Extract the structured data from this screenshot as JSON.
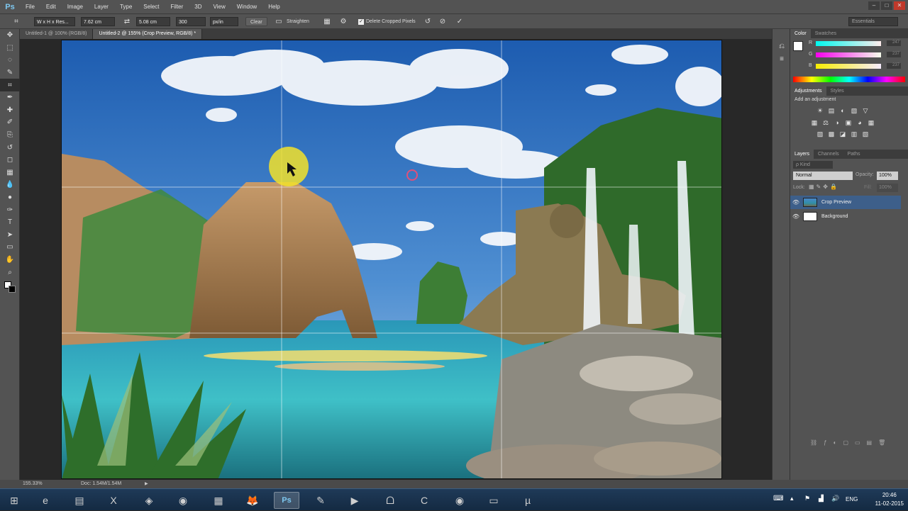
{
  "app": {
    "logo": "Ps",
    "menus": [
      "File",
      "Edit",
      "Image",
      "Layer",
      "Type",
      "Select",
      "Filter",
      "3D",
      "View",
      "Window",
      "Help"
    ],
    "window_controls": [
      "–",
      "□",
      "✕"
    ]
  },
  "options_bar": {
    "ratio_preset": "W x H x Res...",
    "width": "7.62 cm",
    "height": "5.08 cm",
    "resolution": "300",
    "resolution_unit": "px/in",
    "clear_label": "Clear",
    "straighten_label": "Straighten",
    "delete_cropped_label": "Delete Cropped Pixels",
    "delete_cropped_checked": true,
    "workspace": "Essentials"
  },
  "doc_tabs": [
    {
      "label": "Untitled-1 @ 100% (RGB/8)",
      "active": false
    },
    {
      "label": "Untitled-2 @ 155% (Crop Preview, RGB/8) *",
      "active": true
    }
  ],
  "tools": [
    "move-tool",
    "marquee-tool",
    "lasso-tool",
    "quick-select-tool",
    "crop-tool",
    "eyedropper-tool",
    "healing-tool",
    "brush-tool",
    "clone-tool",
    "history-brush-tool",
    "eraser-tool",
    "gradient-tool",
    "blur-tool",
    "dodge-tool",
    "pen-tool",
    "type-tool",
    "path-select-tool",
    "shape-tool",
    "hand-tool",
    "zoom-tool"
  ],
  "tool_glyphs": [
    "✥",
    "⬚",
    "◌",
    "✎",
    "⌗",
    "✒",
    "✚",
    "✐",
    "⎘",
    "↺",
    "◻",
    "▦",
    "💧",
    "●",
    "✑",
    "T",
    "➤",
    "▭",
    "✋",
    "⌕"
  ],
  "color_panel": {
    "tabs": [
      "Color",
      "Swatches"
    ],
    "sliders": [
      {
        "label": "R",
        "value": "247",
        "gradient": "#ff00ff"
      },
      {
        "label": "G",
        "value": "237",
        "gradient": "#f7f700"
      },
      {
        "label": "B",
        "value": "237",
        "gradient": "#f7f7ff"
      }
    ]
  },
  "adjustments_panel": {
    "tabs": [
      "Adjustments",
      "Styles"
    ],
    "title": "Add an adjustment",
    "row1": [
      "☀",
      "▤",
      "◐",
      "▧",
      "▽"
    ],
    "row2": [
      "▦",
      "⚖",
      "◑",
      "▣",
      "◕",
      "▦"
    ],
    "row3": [
      "▨",
      "▩",
      "◪",
      "▥",
      "▧"
    ]
  },
  "layers_panel": {
    "tabs": [
      "Layers",
      "Channels",
      "Paths"
    ],
    "kind": "ρ Kind",
    "blend_mode": "Normal",
    "opacity_label": "Opacity:",
    "opacity": "100%",
    "lock_label": "Lock:",
    "fill_label": "Fill:",
    "fill": "100%",
    "layers": [
      {
        "name": "Crop Preview",
        "selected": true
      },
      {
        "name": "Background",
        "selected": false
      }
    ]
  },
  "status_bar": {
    "zoom": "155.33%",
    "doc": "Doc: 1.54M/1.54M"
  },
  "taskbar": {
    "apps": [
      "start",
      "internet-explorer",
      "file-explorer",
      "excel",
      "camtasia",
      "chrome",
      "metro",
      "firefox",
      "photoshop",
      "notepad",
      "vlc",
      "kinect",
      "camtasia-recorder",
      "opera",
      "network-folder",
      "utorrent"
    ],
    "glyphs": [
      "⊞",
      "e",
      "▤",
      "X",
      "◈",
      "◉",
      "▦",
      "🦊",
      "Ps",
      "✎",
      "▶",
      "ᗝ",
      "C",
      "◉",
      "▭",
      "µ"
    ],
    "active_app": "photoshop",
    "language": "ENG",
    "time": "20:46",
    "date": "11-02-2015"
  },
  "colors": {
    "chrome": "#535353",
    "dark": "#282828",
    "selection": "#3d5f8a",
    "crop_grid": "#ffffff"
  }
}
